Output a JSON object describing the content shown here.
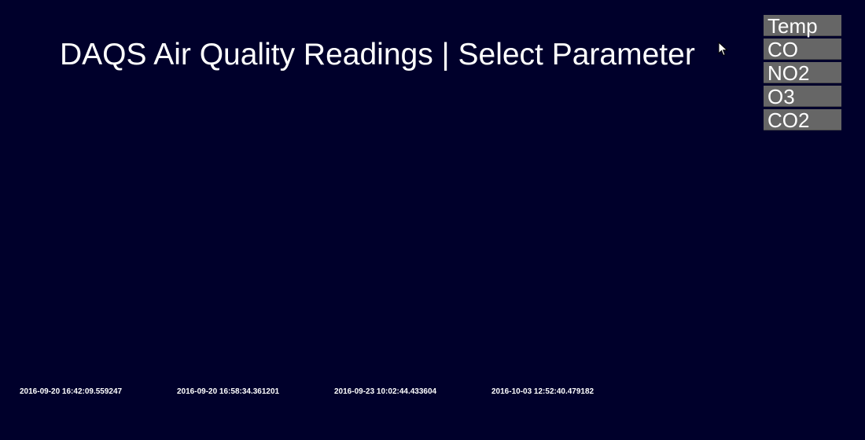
{
  "header": {
    "title": "DAQS Air Quality Readings | Select Parameter"
  },
  "parameters": [
    {
      "label": "Temp"
    },
    {
      "label": "CO"
    },
    {
      "label": "NO2"
    },
    {
      "label": "O3"
    },
    {
      "label": "CO2"
    }
  ],
  "timeline": {
    "timestamps": [
      "2016-09-20 16:42:09.559247",
      "2016-09-20 16:58:34.361201",
      "2016-09-23 10:02:44.433604",
      "2016-10-03 12:52:40.479182"
    ]
  },
  "colors": {
    "background": "#00002b",
    "button_bg": "#666666",
    "text": "#ffffff"
  },
  "icons": {
    "cursor": "mouse-pointer-icon"
  }
}
